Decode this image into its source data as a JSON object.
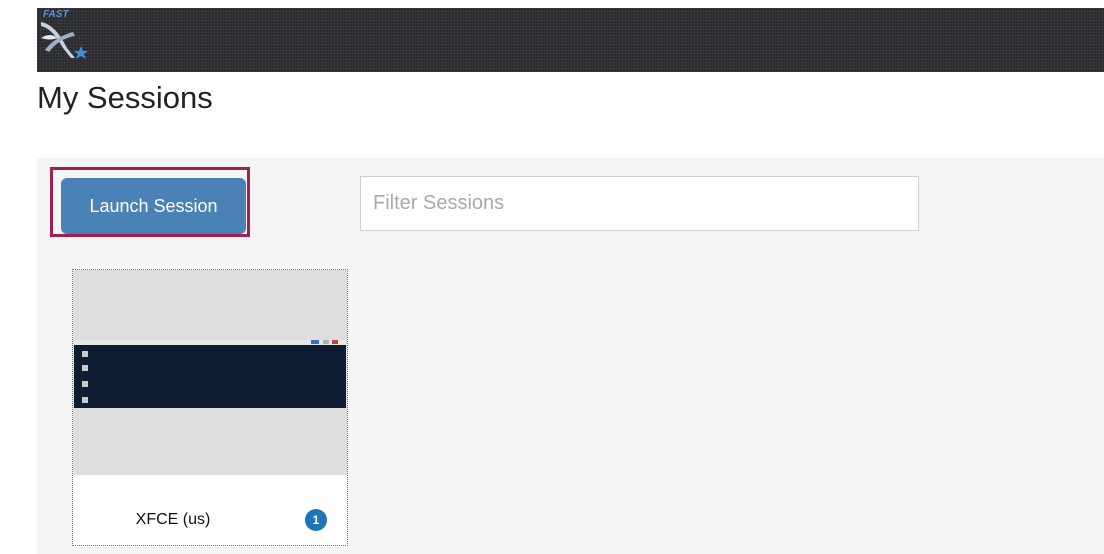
{
  "header": {
    "logo_text": "FAST",
    "logo_icon": "fastx-logo-icon",
    "background_color": "#2a2b2e"
  },
  "page": {
    "title": "My Sessions"
  },
  "toolbar": {
    "launch_label": "Launch Session",
    "launch_color": "#4a82b8",
    "highlight_color": "#a3214f",
    "filter_placeholder": "Filter Sessions",
    "filter_value": ""
  },
  "sessions": [
    {
      "name": "XFCE (us)",
      "badge_count": "1",
      "badge_color": "#1f73b7",
      "thumbnail_icon": "desktop-thumbnail"
    }
  ]
}
